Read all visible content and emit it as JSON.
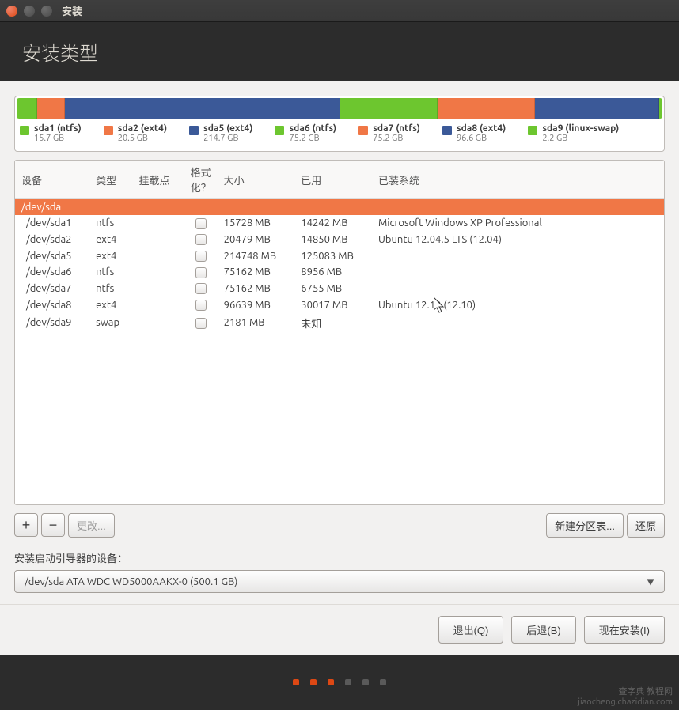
{
  "window": {
    "title": "安装"
  },
  "header": {
    "title": "安装类型"
  },
  "colors": {
    "green": "#6dc62f",
    "orange": "#f07746",
    "blue": "#3b5998"
  },
  "partition_legend": [
    {
      "name": "sda1 (ntfs)",
      "size": "15.7 GB",
      "color": "green",
      "pct": 3.14
    },
    {
      "name": "sda2 (ext4)",
      "size": "20.5 GB",
      "color": "orange",
      "pct": 4.1
    },
    {
      "name": "sda5 (ext4)",
      "size": "214.7 GB",
      "color": "blue",
      "pct": 42.94
    },
    {
      "name": "sda6 (ntfs)",
      "size": "75.2 GB",
      "color": "green",
      "pct": 15.04
    },
    {
      "name": "sda7 (ntfs)",
      "size": "75.2 GB",
      "color": "orange",
      "pct": 15.04
    },
    {
      "name": "sda8 (ext4)",
      "size": "96.6 GB",
      "color": "blue",
      "pct": 19.3
    },
    {
      "name": "sda9 (linux-swap)",
      "size": "2.2 GB",
      "color": "green",
      "pct": 0.44
    }
  ],
  "table": {
    "headers": {
      "device": "设备",
      "type": "类型",
      "mount": "挂载点",
      "format": "格式化？",
      "size": "大小",
      "used": "已用",
      "system": "已装系统"
    },
    "disk_row": "/dev/sda",
    "rows": [
      {
        "device": "/dev/sda1",
        "type": "ntfs",
        "mount": "",
        "size": "15728 MB",
        "used": "14242 MB",
        "system": "Microsoft Windows XP Professional"
      },
      {
        "device": "/dev/sda2",
        "type": "ext4",
        "mount": "",
        "size": "20479 MB",
        "used": "14850 MB",
        "system": "Ubuntu 12.04.5 LTS (12.04)"
      },
      {
        "device": "/dev/sda5",
        "type": "ext4",
        "mount": "",
        "size": "214748 MB",
        "used": "125083 MB",
        "system": ""
      },
      {
        "device": "/dev/sda6",
        "type": "ntfs",
        "mount": "",
        "size": "75162 MB",
        "used": "8956 MB",
        "system": ""
      },
      {
        "device": "/dev/sda7",
        "type": "ntfs",
        "mount": "",
        "size": "75162 MB",
        "used": "6755 MB",
        "system": ""
      },
      {
        "device": "/dev/sda8",
        "type": "ext4",
        "mount": "",
        "size": "96639 MB",
        "used": "30017 MB",
        "system": "Ubuntu 12.10 (12.10)"
      },
      {
        "device": "/dev/sda9",
        "type": "swap",
        "mount": "",
        "size": "2181 MB",
        "used": "未知",
        "system": ""
      }
    ]
  },
  "toolbar": {
    "add": "+",
    "remove": "−",
    "change": "更改...",
    "new_table": "新建分区表...",
    "revert": "还原"
  },
  "bootloader": {
    "label": "安装启动引导器的设备：",
    "value": "/dev/sda    ATA WDC WD5000AAKX-0 (500.1 GB)"
  },
  "footer": {
    "quit": "退出(Q)",
    "back": "后退(B)",
    "install": "现在安装(I)"
  },
  "steps": {
    "total": 6,
    "active": 3
  },
  "watermark": {
    "line1": "查字典 教程网",
    "line2": "jiaocheng.chazidian.com"
  }
}
